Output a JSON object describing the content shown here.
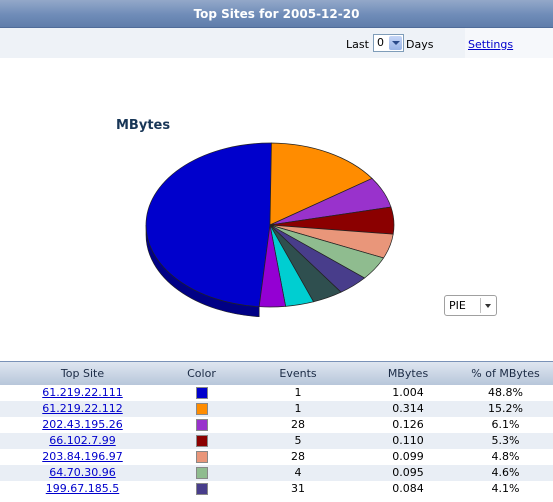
{
  "title": "Top Sites for 2005-12-20",
  "controls": {
    "last_label": "Last",
    "last_value": "0",
    "days_label": "Days",
    "settings_label": "Settings"
  },
  "chart": {
    "title": "MBytes",
    "type_selected": "PIE"
  },
  "table": {
    "headers": [
      "Top Site",
      "Color",
      "Events",
      "MBytes",
      "% of MBytes"
    ],
    "rows": [
      {
        "site": "61.219.22.111",
        "color": "#0000cc",
        "events": "1",
        "mbytes": "1.004",
        "pct": "48.8%"
      },
      {
        "site": "61.219.22.112",
        "color": "#ff8c00",
        "events": "1",
        "mbytes": "0.314",
        "pct": "15.2%"
      },
      {
        "site": "202.43.195.26",
        "color": "#9932cc",
        "events": "28",
        "mbytes": "0.126",
        "pct": "6.1%"
      },
      {
        "site": "66.102.7.99",
        "color": "#8b0000",
        "events": "5",
        "mbytes": "0.110",
        "pct": "5.3%"
      },
      {
        "site": "203.84.196.97",
        "color": "#e9967a",
        "events": "28",
        "mbytes": "0.099",
        "pct": "4.8%"
      },
      {
        "site": "64.70.30.96",
        "color": "#8fbc8f",
        "events": "4",
        "mbytes": "0.095",
        "pct": "4.6%"
      },
      {
        "site": "199.67.185.5",
        "color": "#483d8b",
        "events": "31",
        "mbytes": "0.084",
        "pct": "4.1%"
      }
    ]
  },
  "chart_data": {
    "type": "pie",
    "title": "MBytes",
    "categories": [
      "61.219.22.111",
      "61.219.22.112",
      "202.43.195.26",
      "66.102.7.99",
      "203.84.196.97",
      "64.70.30.96",
      "199.67.185.5",
      "",
      "",
      ""
    ],
    "values": [
      48.8,
      15.2,
      6.1,
      5.3,
      4.8,
      4.6,
      4.1,
      4.0,
      3.7,
      3.4
    ],
    "colors": [
      "#0000cc",
      "#ff8c00",
      "#9932cc",
      "#8b0000",
      "#e9967a",
      "#8fbc8f",
      "#483d8b",
      "#2f4f4f",
      "#00ced1",
      "#9400d3"
    ]
  }
}
